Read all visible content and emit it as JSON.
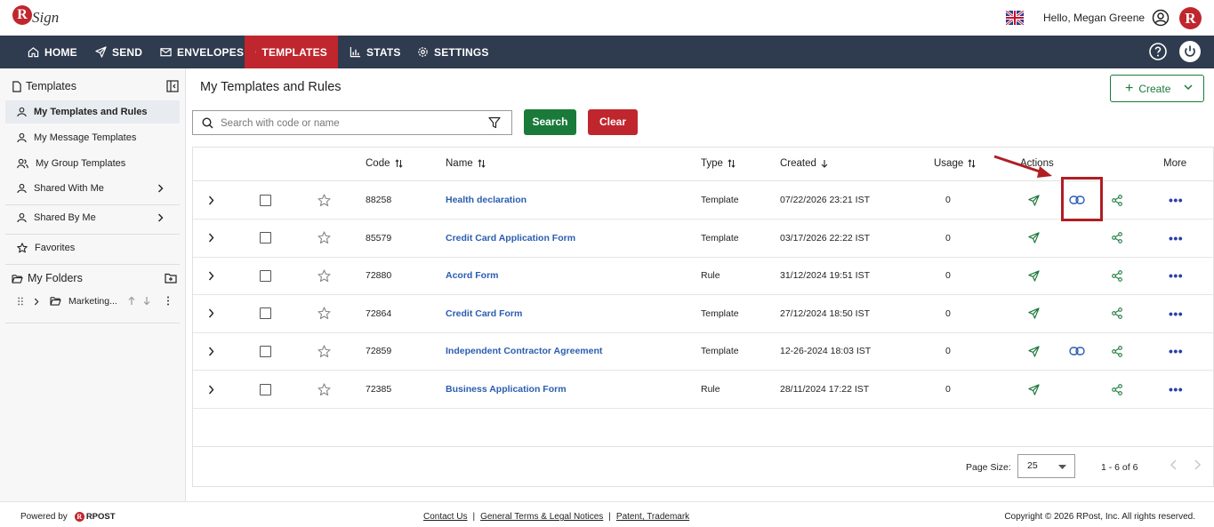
{
  "header": {
    "logo_letter": "R",
    "logo_word": "Sign",
    "greeting": "Hello, Megan Greene",
    "brand_badge": "R"
  },
  "nav": {
    "items": [
      {
        "label": "HOME",
        "icon": "home-icon"
      },
      {
        "label": "SEND",
        "icon": "send-icon"
      },
      {
        "label": "ENVELOPES",
        "icon": "envelope-icon"
      },
      {
        "label": "TEMPLATES",
        "icon": "document-icon",
        "active": true
      },
      {
        "label": "STATS",
        "icon": "bar-chart-icon"
      },
      {
        "label": "SETTINGS",
        "icon": "gear-icon"
      }
    ]
  },
  "sidebar": {
    "title": "Templates",
    "items": [
      {
        "label": "My Templates and Rules",
        "icon": "user-icon",
        "active": true
      },
      {
        "label": "My Message Templates",
        "icon": "user-icon"
      },
      {
        "label": "My Group Templates",
        "icon": "group-icon"
      },
      {
        "label": "Shared With Me",
        "icon": "user-icon"
      },
      {
        "label": "Shared By Me",
        "icon": "user-icon"
      },
      {
        "label": "Favorites",
        "icon": "star-icon"
      }
    ],
    "folders_title": "My Folders",
    "folder": {
      "name": "Marketing..."
    }
  },
  "main": {
    "title": "My Templates and Rules",
    "create_label": "Create",
    "search_placeholder": "Search with code or name",
    "search_label": "Search",
    "clear_label": "Clear"
  },
  "table": {
    "headers": {
      "code": "Code",
      "name": "Name",
      "type": "Type",
      "created": "Created",
      "usage": "Usage",
      "actions": "Actions",
      "more": "More"
    },
    "rows": [
      {
        "code": "88258",
        "name": "Health declaration",
        "type": "Template",
        "created": "07/22/2026 23:21 IST",
        "usage": "0",
        "has_link": true
      },
      {
        "code": "85579",
        "name": "Credit Card Application Form",
        "type": "Template",
        "created": "03/17/2026 22:22 IST",
        "usage": "0",
        "has_link": false
      },
      {
        "code": "72880",
        "name": "Acord Form",
        "type": "Rule",
        "created": "31/12/2024 19:51 IST",
        "usage": "0",
        "has_link": false
      },
      {
        "code": "72864",
        "name": "Credit Card Form",
        "type": "Template",
        "created": "27/12/2024 18:50 IST",
        "usage": "0",
        "has_link": false
      },
      {
        "code": "72859",
        "name": "Independent Contractor Agreement",
        "type": "Template",
        "created": "12-26-2024 18:03 IST",
        "usage": "0",
        "has_link": true
      },
      {
        "code": "72385",
        "name": "Business Application Form",
        "type": "Rule",
        "created": "28/11/2024 17:22 IST",
        "usage": "0",
        "has_link": false
      }
    ],
    "page_size_label": "Page Size:",
    "page_size": "25",
    "range": "1 - 6 of 6"
  },
  "footer": {
    "powered_by": "Powered by",
    "rpost": "RPOST",
    "links": [
      "Contact Us",
      "General Terms & Legal Notices",
      "Patent, Trademark"
    ],
    "copyright": "Copyright © 2026 RPost, Inc. All rights reserved."
  },
  "colors": {
    "nav_bg": "#2f3b4e",
    "accent_red": "#c0262d",
    "accent_green": "#1a7a3a",
    "link_blue": "#2a5db0"
  }
}
